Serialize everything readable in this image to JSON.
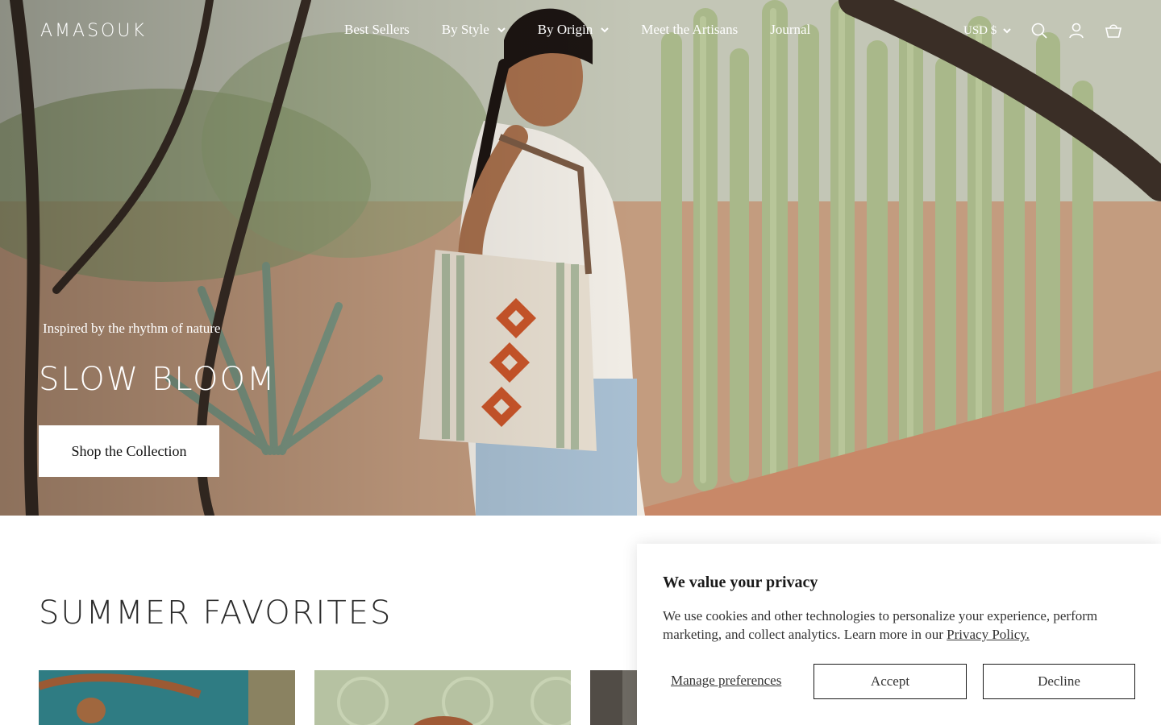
{
  "header": {
    "logo": "AMASOUK",
    "nav": [
      {
        "label": "Best Sellers",
        "has_dropdown": false
      },
      {
        "label": "By Style",
        "has_dropdown": true
      },
      {
        "label": "By Origin",
        "has_dropdown": true
      },
      {
        "label": "Meet the Artisans",
        "has_dropdown": false
      },
      {
        "label": "Journal",
        "has_dropdown": false
      }
    ],
    "currency": "USD $",
    "icons": [
      "search-icon",
      "account-icon",
      "cart-icon"
    ]
  },
  "hero": {
    "eyebrow": "Inspired by the rhythm of nature",
    "title": "SLOW BLOOM",
    "cta": "Shop the Collection"
  },
  "section": {
    "title": "SUMMER FAVORITES"
  },
  "cookie_banner": {
    "title": "We value your privacy",
    "text": "We use cookies and other technologies to personalize your experience, perform marketing, and collect analytics. Learn more in our ",
    "link": "Privacy Policy.",
    "manage": "Manage preferences",
    "accept": "Accept",
    "decline": "Decline"
  },
  "colors": {
    "white": "#ffffff",
    "text": "#1a1a1a",
    "hero_sand": "#c7a184",
    "cactus_green": "#a9b88a"
  }
}
